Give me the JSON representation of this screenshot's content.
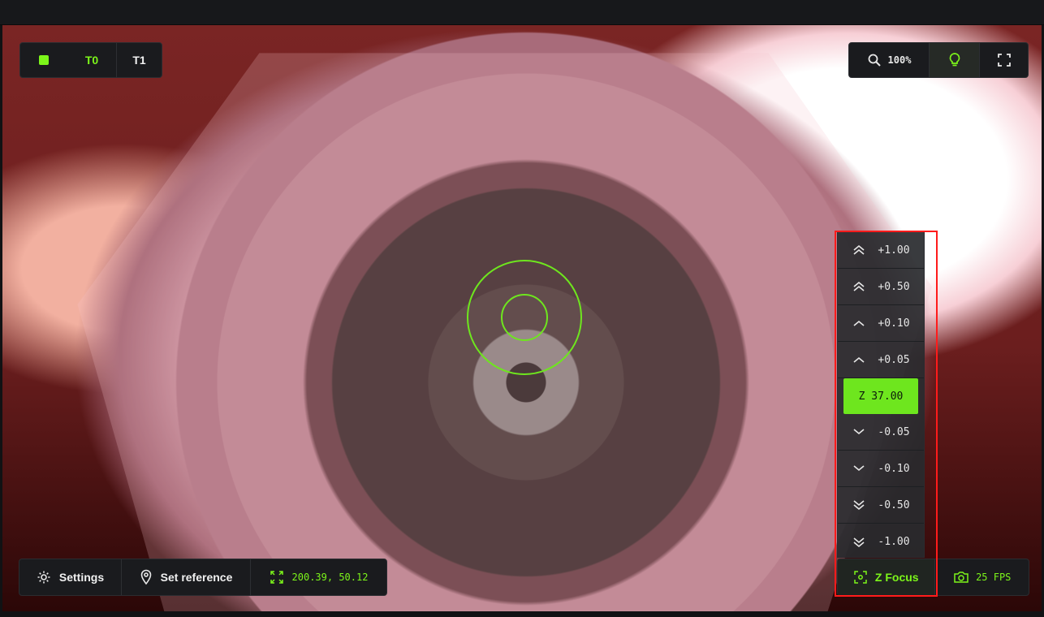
{
  "toolheads": {
    "active_indicator_color": "#7cf51a",
    "t0_label": "T0",
    "t1_label": "T1"
  },
  "view_tools": {
    "zoom_label": "100%",
    "zoom_icon": "magnifier-icon",
    "light_icon": "bulb-icon",
    "fullscreen_icon": "fullscreen-icon"
  },
  "bottom_bar": {
    "settings_label": "Settings",
    "set_reference_label": "Set reference",
    "coordinates": "200.39, 50.12",
    "z_focus_label": "Z Focus",
    "fps_label": "25 FPS"
  },
  "z_panel": {
    "steps_up": [
      "+1.00",
      "+0.50",
      "+0.10",
      "+0.05"
    ],
    "current": "Z 37.00",
    "steps_down": [
      "-0.05",
      "-0.10",
      "-0.50",
      "-1.00"
    ]
  },
  "colors": {
    "accent": "#7cf51a",
    "panel_bg": "#1a1b1e",
    "highlight_box": "#ff1b1b"
  }
}
